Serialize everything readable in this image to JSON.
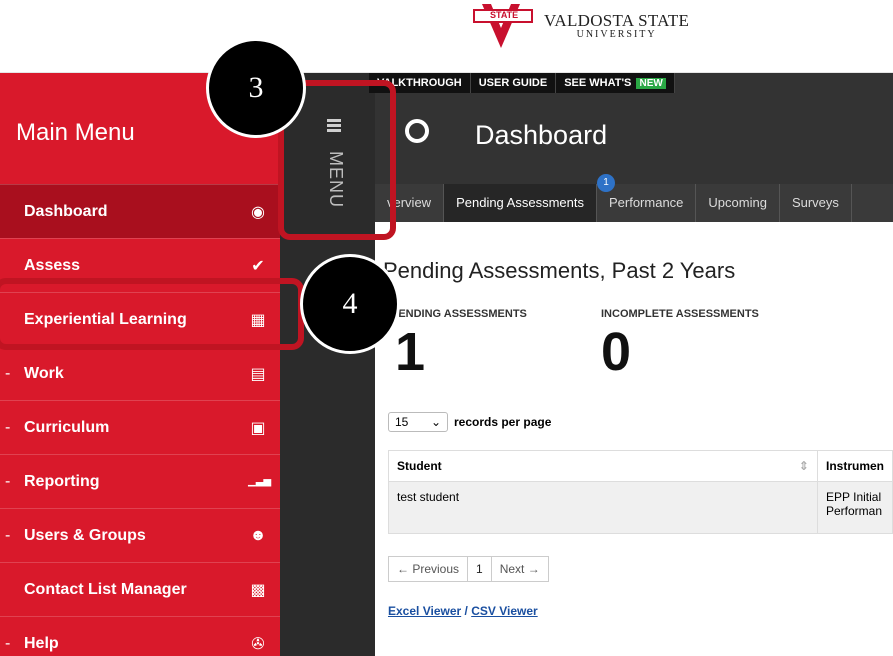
{
  "header": {
    "logo_line1": "VALDOSTA STATE",
    "logo_line2": "UNIVERSITY",
    "logo_seal_text": "STATE"
  },
  "top_links": [
    "VALKTHROUGH",
    "USER GUIDE",
    "SEE WHAT'S"
  ],
  "new_badge": "NEW",
  "sidebar": {
    "title": "Main Menu",
    "items": [
      {
        "label": "Dashboard",
        "icon": "dashboard-icon",
        "glyph": "◉",
        "bullet": ""
      },
      {
        "label": "Assess",
        "icon": "check-icon",
        "glyph": "✔",
        "bullet": ""
      },
      {
        "label": "Experiential Learning",
        "icon": "building-icon",
        "glyph": "▦",
        "bullet": ""
      },
      {
        "label": "Work",
        "icon": "inbox-icon",
        "glyph": "▤",
        "bullet": "-"
      },
      {
        "label": "Curriculum",
        "icon": "book-icon",
        "glyph": "▣",
        "bullet": "-"
      },
      {
        "label": "Reporting",
        "icon": "bar-chart-icon",
        "glyph": "▁▃▅",
        "bullet": "-"
      },
      {
        "label": "Users & Groups",
        "icon": "users-icon",
        "glyph": "☻",
        "bullet": "-"
      },
      {
        "label": "Contact List Manager",
        "icon": "contact-card-icon",
        "glyph": "▩",
        "bullet": ""
      },
      {
        "label": "Help",
        "icon": "life-ring-icon",
        "glyph": "✇",
        "bullet": "-"
      }
    ]
  },
  "menu_strip": {
    "label": "MENU"
  },
  "main": {
    "title": "Dashboard",
    "tabs": [
      "verview",
      "Pending Assessments",
      "Performance",
      "Upcoming",
      "Surveys"
    ],
    "pending_count": "1",
    "section_title": "Pending Assessments, Past 2 Years",
    "stats": [
      {
        "label": "PENDING ASSESSMENTS",
        "value": "1"
      },
      {
        "label": "INCOMPLETE ASSESSMENTS",
        "value": "0"
      }
    ],
    "records_value": "15",
    "records_label": "records per page",
    "table": {
      "headers": [
        "Student",
        "Instrumen"
      ],
      "rows": [
        [
          "test student",
          "EPP Initial Performan"
        ]
      ]
    },
    "pager": {
      "prev": "← Previous",
      "page": "1",
      "next": "Next →"
    },
    "viewers": {
      "excel": "Excel Viewer",
      "sep": " / ",
      "csv": "CSV Viewer"
    }
  },
  "callouts": [
    "3",
    "4"
  ],
  "colors": {
    "sidebar": "#d9192b",
    "active": "#a90f1e",
    "callout_border": "#c01422"
  }
}
